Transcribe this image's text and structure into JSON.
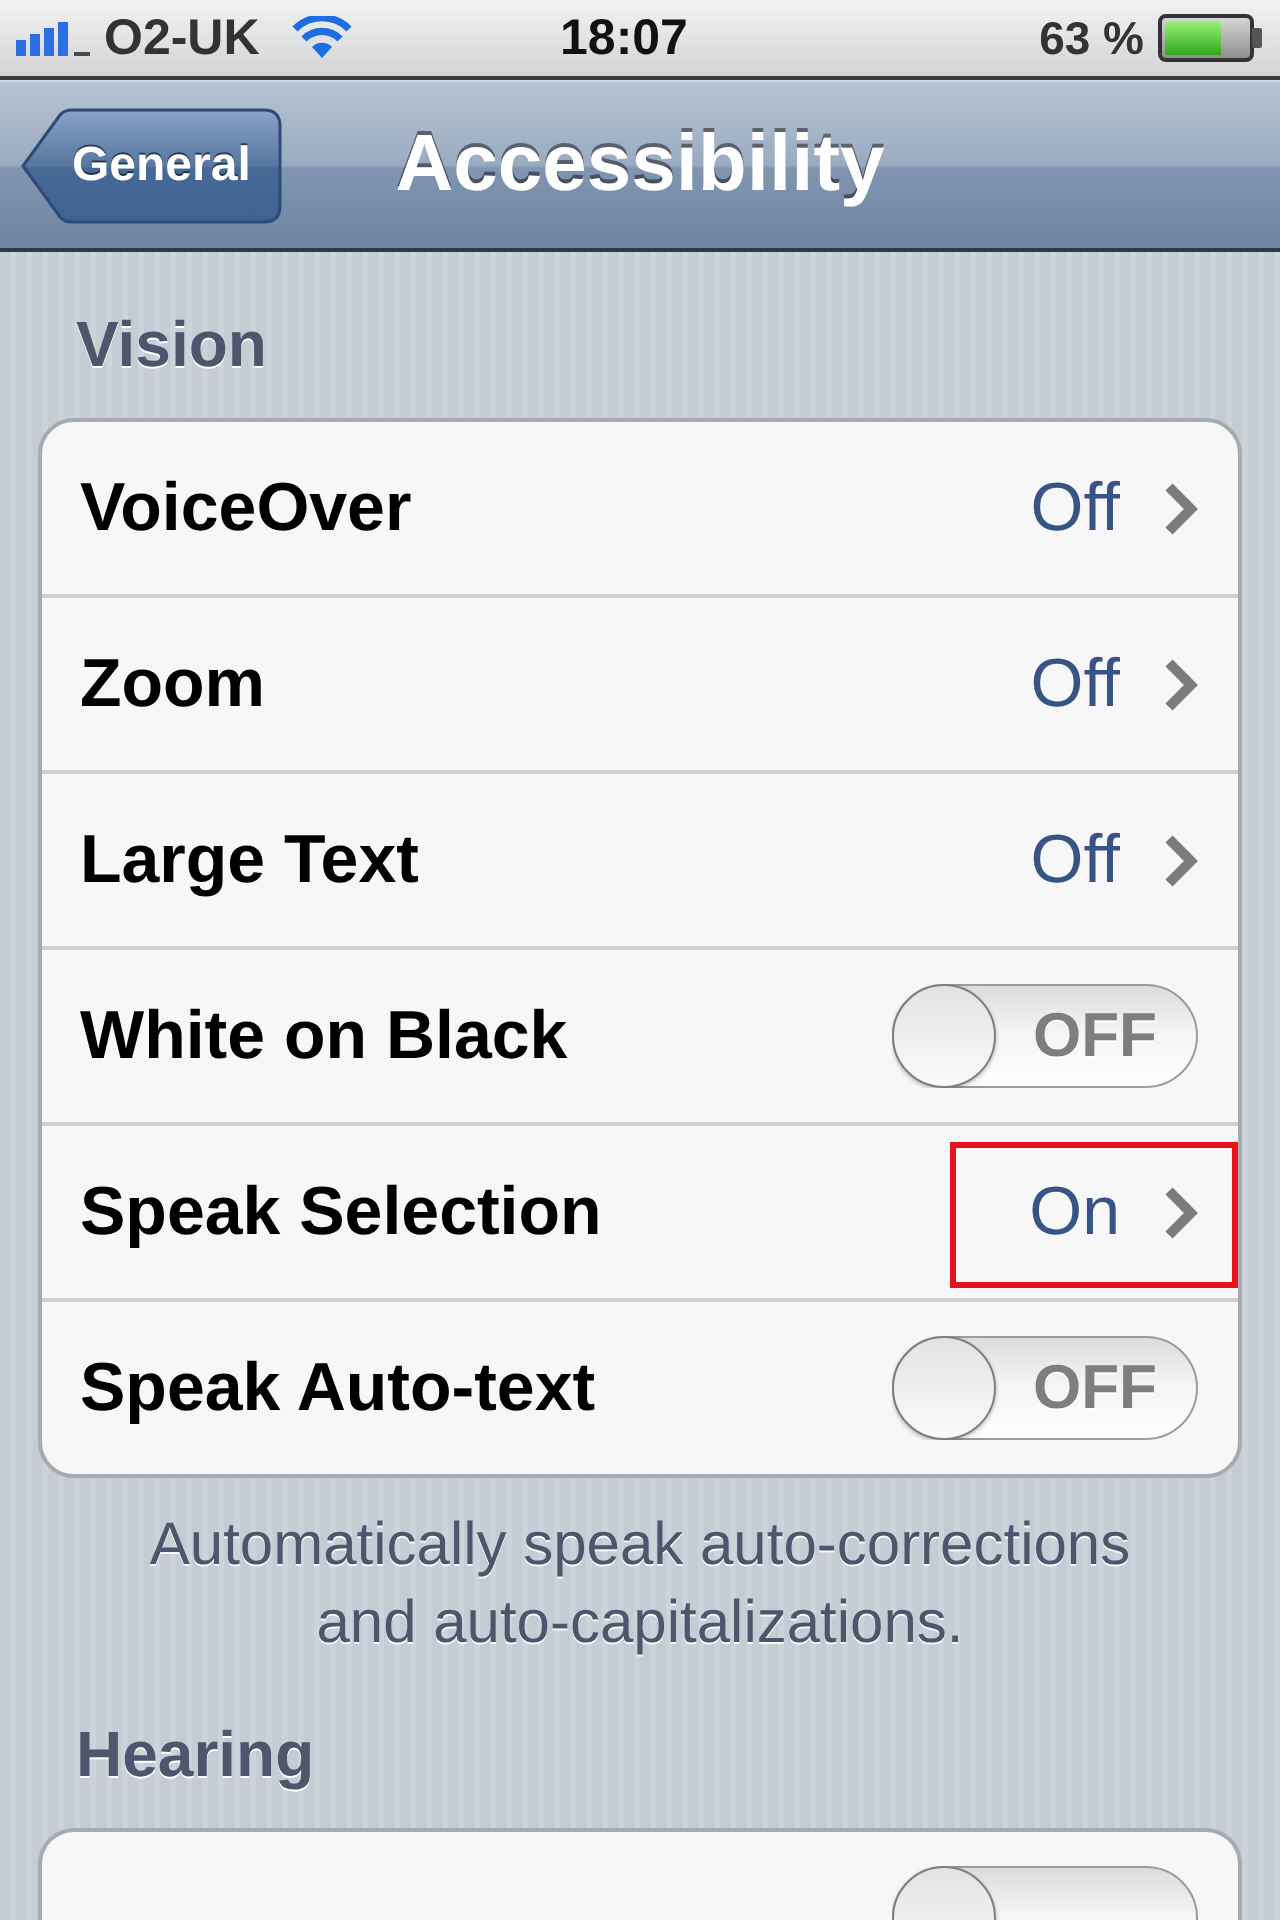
{
  "status_bar": {
    "carrier": "O2-UK",
    "time": "18:07",
    "battery": "63 %"
  },
  "nav_bar": {
    "back_button": "General",
    "title": "Accessibility"
  },
  "sections": [
    {
      "header": "Vision",
      "rows": [
        {
          "kind": "disclosure",
          "label": "VoiceOver",
          "value": "Off",
          "highlighted": false
        },
        {
          "kind": "disclosure",
          "label": "Zoom",
          "value": "Off",
          "highlighted": false
        },
        {
          "kind": "disclosure",
          "label": "Large Text",
          "value": "Off",
          "highlighted": false
        },
        {
          "kind": "toggle",
          "label": "White on Black",
          "on": false,
          "state_text": "OFF",
          "highlighted": false
        },
        {
          "kind": "disclosure",
          "label": "Speak Selection",
          "value": "On",
          "highlighted": true
        },
        {
          "kind": "toggle",
          "label": "Speak Auto-text",
          "on": false,
          "state_text": "OFF",
          "highlighted": false
        }
      ],
      "footer": "Automatically speak auto-corrections and auto-capitalizations."
    },
    {
      "header": "Hearing",
      "rows": [
        {
          "kind": "toggle",
          "on": false,
          "highlighted": false
        }
      ]
    }
  ]
}
